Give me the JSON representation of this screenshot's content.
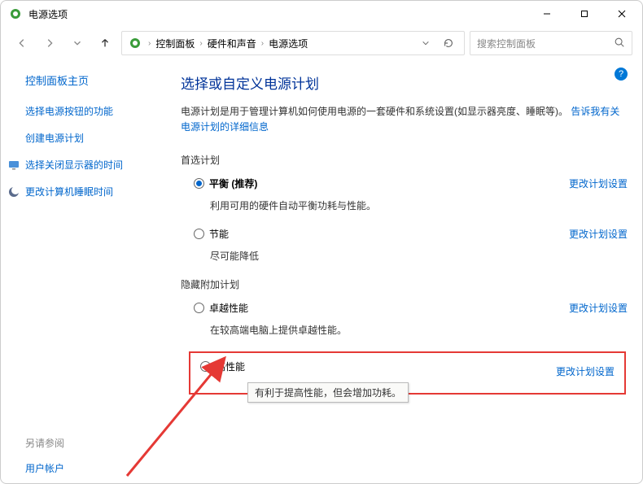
{
  "window": {
    "title": "电源选项"
  },
  "breadcrumb": {
    "c1": "控制面板",
    "c2": "硬件和声音",
    "c3": "电源选项"
  },
  "search": {
    "placeholder": "搜索控制面板"
  },
  "sidebar": {
    "home": "控制面板主页",
    "link1": "选择电源按钮的功能",
    "link2": "创建电源计划",
    "link3": "选择关闭显示器的时间",
    "link4": "更改计算机睡眠时间",
    "footer_label": "另请参阅",
    "footer_link": "用户帐户"
  },
  "main": {
    "heading": "选择或自定义电源计划",
    "intro_text": "电源计划是用于管理计算机如何使用电源的一套硬件和系统设置(如显示器亮度、睡眠等)。",
    "intro_link": "告诉我有关电源计划的详细信息",
    "preferred_label": "首选计划",
    "hidden_label": "隐藏附加计划",
    "change_link": "更改计划设置",
    "plans": {
      "balanced": {
        "name": "平衡 (推荐)",
        "desc": "利用可用的硬件自动平衡功耗与性能。"
      },
      "saver": {
        "name": "节能",
        "desc": "尽可能降低"
      },
      "ultimate": {
        "name": "卓越性能",
        "desc": "在较高端电脑上提供卓越性能。"
      },
      "high": {
        "name": "高性能",
        "desc_partial": "有利于提高性能，但会增加功耗。",
        "tooltip": "有利于提高性能，但会增加功耗。"
      }
    }
  }
}
